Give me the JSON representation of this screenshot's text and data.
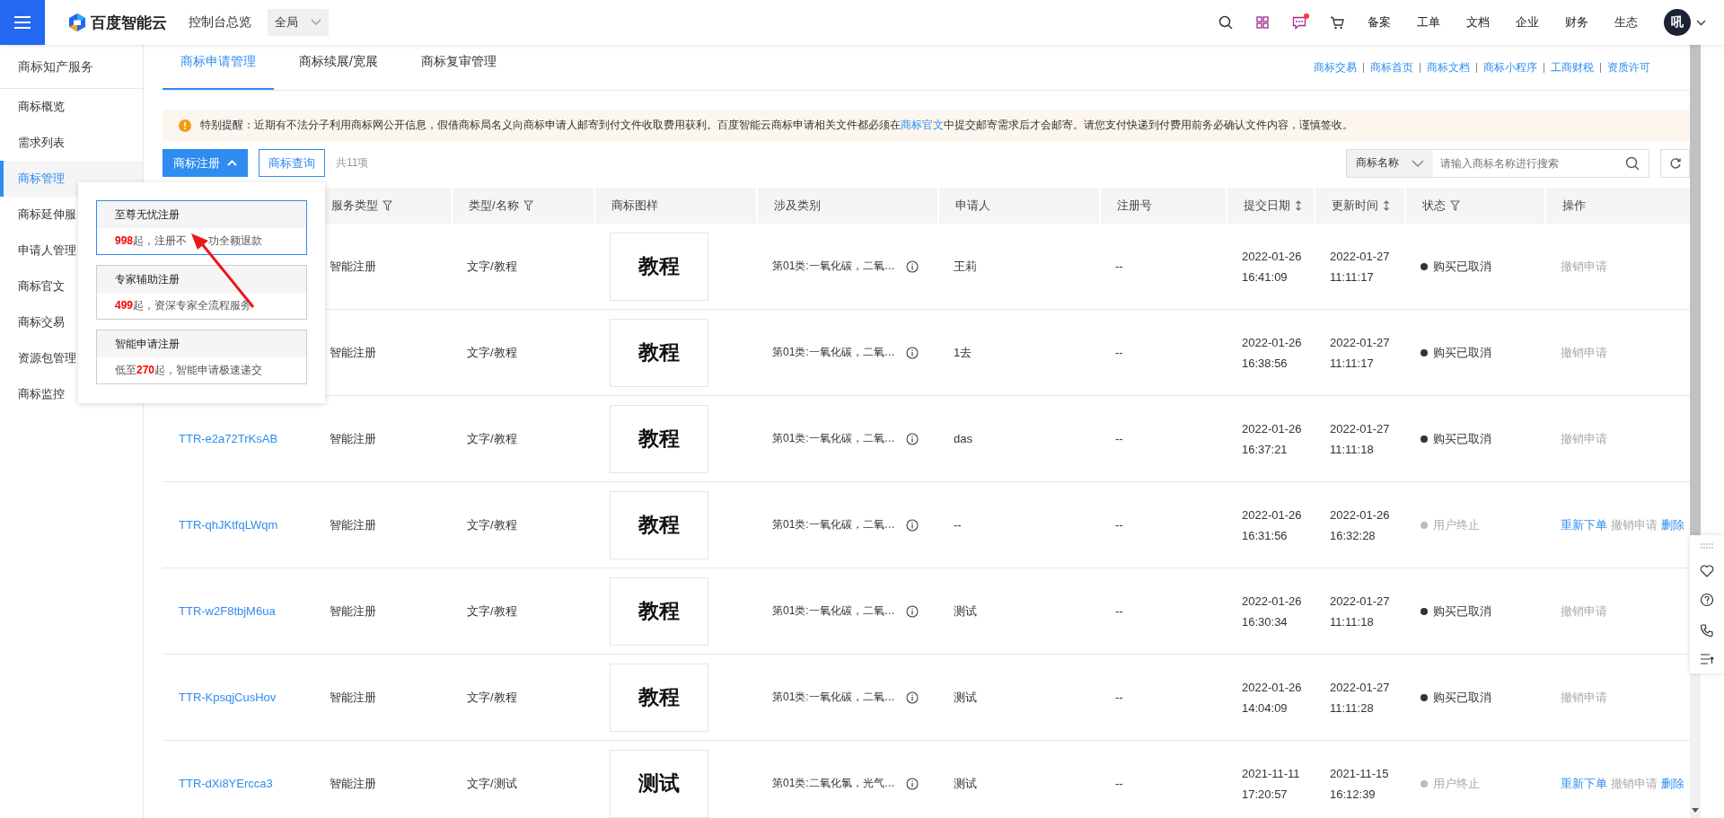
{
  "topbar": {
    "brand": "百度智能云",
    "console": "控制台总览",
    "region": "全局",
    "nav": [
      "备案",
      "工单",
      "文档",
      "企业",
      "财务",
      "生态"
    ],
    "avatar": "吼",
    "message_unread": true
  },
  "sidebar": {
    "title": "商标知产服务",
    "items": [
      {
        "label": "商标概览",
        "selected": false
      },
      {
        "label": "需求列表",
        "selected": false
      },
      {
        "label": "商标管理",
        "selected": true
      },
      {
        "label": "商标延伸服",
        "selected": false
      },
      {
        "label": "申请人管理",
        "selected": false
      },
      {
        "label": "商标官文",
        "selected": false
      },
      {
        "label": "商标交易",
        "selected": false
      },
      {
        "label": "资源包管理",
        "selected": false
      },
      {
        "label": "商标监控",
        "selected": false
      }
    ]
  },
  "tabs": [
    {
      "label": "商标申请管理",
      "selected": true
    },
    {
      "label": "商标续展/宽展",
      "selected": false
    },
    {
      "label": "商标复审管理",
      "selected": false
    }
  ],
  "quick_links": [
    "商标交易",
    "商标首页",
    "商标文档",
    "商标小程序",
    "工商财税",
    "资质许可"
  ],
  "notice": {
    "before": "特别提醒：近期有不法分子利用商标网公开信息，假借商标局名义向商标申请人邮寄到付文件收取费用获利。百度智能云商标申请相关文件都必须在",
    "link": "商标官文",
    "after": "中提交邮寄需求后才会邮寄。请您支付快递到付费用前务必确认文件内容，谨慎签收。"
  },
  "toolbar": {
    "register_button": {
      "label": "商标注册",
      "expanded": true
    },
    "query_button": "商标查询",
    "total": "共11项",
    "search_select": "商标名称",
    "search_placeholder": "请输入商标名称进行搜索"
  },
  "register_menu": [
    {
      "title": "至尊无忧注册",
      "price": "998",
      "suffix": "起，注册不",
      "suffix_after_arrow": "功全额退款",
      "selected": true
    },
    {
      "title": "专家辅助注册",
      "price": "499",
      "suffix": "起，资深专家全流程服务",
      "selected": false
    },
    {
      "title": "智能申请注册",
      "prefix": "低至",
      "price": "270",
      "suffix": "起，智能申请极速递交",
      "selected": false
    }
  ],
  "table": {
    "columns": [
      {
        "kind": "plain"
      },
      {
        "label": "服务类型",
        "kind": "filter"
      },
      {
        "label": "类型/名称",
        "kind": "filter"
      },
      {
        "label": "商标图样",
        "kind": "plain"
      },
      {
        "label": "涉及类别",
        "kind": "plain"
      },
      {
        "label": "申请人",
        "kind": "plain"
      },
      {
        "label": "注册号",
        "kind": "plain"
      },
      {
        "label": "提交日期",
        "kind": "sort"
      },
      {
        "label": "更新时间",
        "kind": "sort"
      },
      {
        "label": "状态",
        "kind": "filter"
      },
      {
        "label": "操作",
        "kind": "plain"
      }
    ],
    "rows": [
      {
        "service": "智能注册",
        "type_name": "文字/教程",
        "sample": "教程",
        "classes": "第01类:一氧化碳，二氧…",
        "applicant": "王莉",
        "reg_no": "--",
        "submit_date": "2022-01-26",
        "submit_time": "16:41:09",
        "update_date": "2022-01-27",
        "update_time": "11:11:17",
        "status": "购买已取消",
        "terminated": false,
        "actions": [
          {
            "label": "撤销申请",
            "disabled": true
          }
        ]
      },
      {
        "service": "智能注册",
        "type_name": "文字/教程",
        "sample": "教程",
        "classes": "第01类:一氧化碳，二氧…",
        "applicant": "1去",
        "reg_no": "--",
        "submit_date": "2022-01-26",
        "submit_time": "16:38:56",
        "update_date": "2022-01-27",
        "update_time": "11:11:17",
        "status": "购买已取消",
        "terminated": false,
        "actions": [
          {
            "label": "撤销申请",
            "disabled": true
          }
        ]
      },
      {
        "id": "TTR-e2a72TrKsAB",
        "service": "智能注册",
        "type_name": "文字/教程",
        "sample": "教程",
        "classes": "第01类:一氧化碳，二氧…",
        "applicant": "das",
        "reg_no": "--",
        "submit_date": "2022-01-26",
        "submit_time": "16:37:21",
        "update_date": "2022-01-27",
        "update_time": "11:11:18",
        "status": "购买已取消",
        "terminated": false,
        "actions": [
          {
            "label": "撤销申请",
            "disabled": true
          }
        ]
      },
      {
        "id": "TTR-qhJKtfqLWqm",
        "service": "智能注册",
        "type_name": "文字/教程",
        "sample": "教程",
        "classes": "第01类:一氧化碳，二氧…",
        "applicant": "--",
        "reg_no": "--",
        "submit_date": "2022-01-26",
        "submit_time": "16:31:56",
        "update_date": "2022-01-26",
        "update_time": "16:32:28",
        "status": "用户终止",
        "terminated": true,
        "actions": [
          {
            "label": "重新下单",
            "disabled": false
          },
          {
            "label": "撤销申请",
            "disabled": true
          },
          {
            "label": "删除",
            "disabled": false
          }
        ]
      },
      {
        "id": "TTR-w2F8tbjM6ua",
        "service": "智能注册",
        "type_name": "文字/教程",
        "sample": "教程",
        "classes": "第01类:一氧化碳，二氧…",
        "applicant": "测试",
        "reg_no": "--",
        "submit_date": "2022-01-26",
        "submit_time": "16:30:34",
        "update_date": "2022-01-27",
        "update_time": "11:11:18",
        "status": "购买已取消",
        "terminated": false,
        "actions": [
          {
            "label": "撤销申请",
            "disabled": true
          }
        ]
      },
      {
        "id": "TTR-KpsqjCusHov",
        "service": "智能注册",
        "type_name": "文字/教程",
        "sample": "教程",
        "classes": "第01类:一氧化碳，二氧…",
        "applicant": "测试",
        "reg_no": "--",
        "submit_date": "2022-01-26",
        "submit_time": "14:04:09",
        "update_date": "2022-01-27",
        "update_time": "11:11:28",
        "status": "购买已取消",
        "terminated": false,
        "actions": [
          {
            "label": "撤销申请",
            "disabled": true
          }
        ]
      },
      {
        "id": "TTR-dXi8YErcca3",
        "service": "智能注册",
        "type_name": "文字/测试",
        "sample": "测试",
        "classes": "第01类:二氧化氯，光气…",
        "applicant": "测试",
        "reg_no": "--",
        "submit_date": "2021-11-11",
        "submit_time": "17:20:57",
        "update_date": "2021-11-15",
        "update_time": "16:12:39",
        "status": "用户终止",
        "terminated": true,
        "actions": [
          {
            "label": "重新下单",
            "disabled": false
          },
          {
            "label": "撤销申请",
            "disabled": true
          },
          {
            "label": "删除",
            "disabled": false
          }
        ]
      }
    ]
  }
}
